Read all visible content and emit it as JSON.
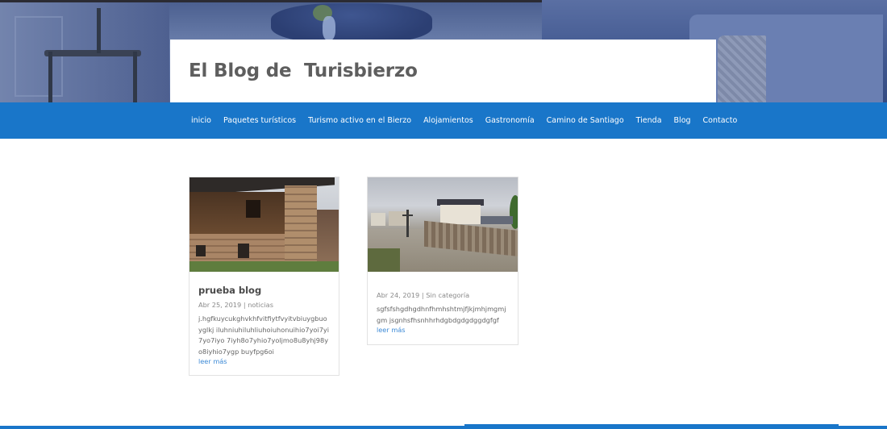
{
  "site": {
    "title": "El Blog de  Turisbierzo"
  },
  "nav": {
    "items": [
      {
        "label": "inicio"
      },
      {
        "label": "Paquetes turísticos"
      },
      {
        "label": "Turismo activo en el Bierzo"
      },
      {
        "label": "Alojamientos"
      },
      {
        "label": "Gastronomía"
      },
      {
        "label": "Camino de Santiago"
      },
      {
        "label": "Tienda"
      },
      {
        "label": "Blog"
      },
      {
        "label": "Contacto"
      }
    ]
  },
  "posts": [
    {
      "title": "prueba blog",
      "date": "Abr 25, 2019",
      "separator": "|",
      "category": "noticias",
      "excerpt": "j.hgfkuycukghvkhfvitfiytfvyitvbiuygbuoyglkj iluhniuhiluhliuhoiuhonuihio7yoi7yi7yo7iyo 7iyh8o7yhio7yoljmo8u8yhj98yo8iyhio7ygp buyfpg6oi",
      "read_more": "leer más",
      "image": "stone-house-photo"
    },
    {
      "title": "",
      "date": "Abr 24, 2019",
      "separator": "|",
      "category": "Sin categoría",
      "excerpt": "sgfsfshgdhgdhnfhmhshtmjfjkjmhjmgmjgm jsgnhsfhsnhhrhdgbdgdgdggdgfgf",
      "read_more": "leer más",
      "image": "village-street-photo"
    }
  ],
  "colors": {
    "nav_bg": "#1976c9",
    "link": "#3d8ad6",
    "title": "#5e5e5e"
  }
}
